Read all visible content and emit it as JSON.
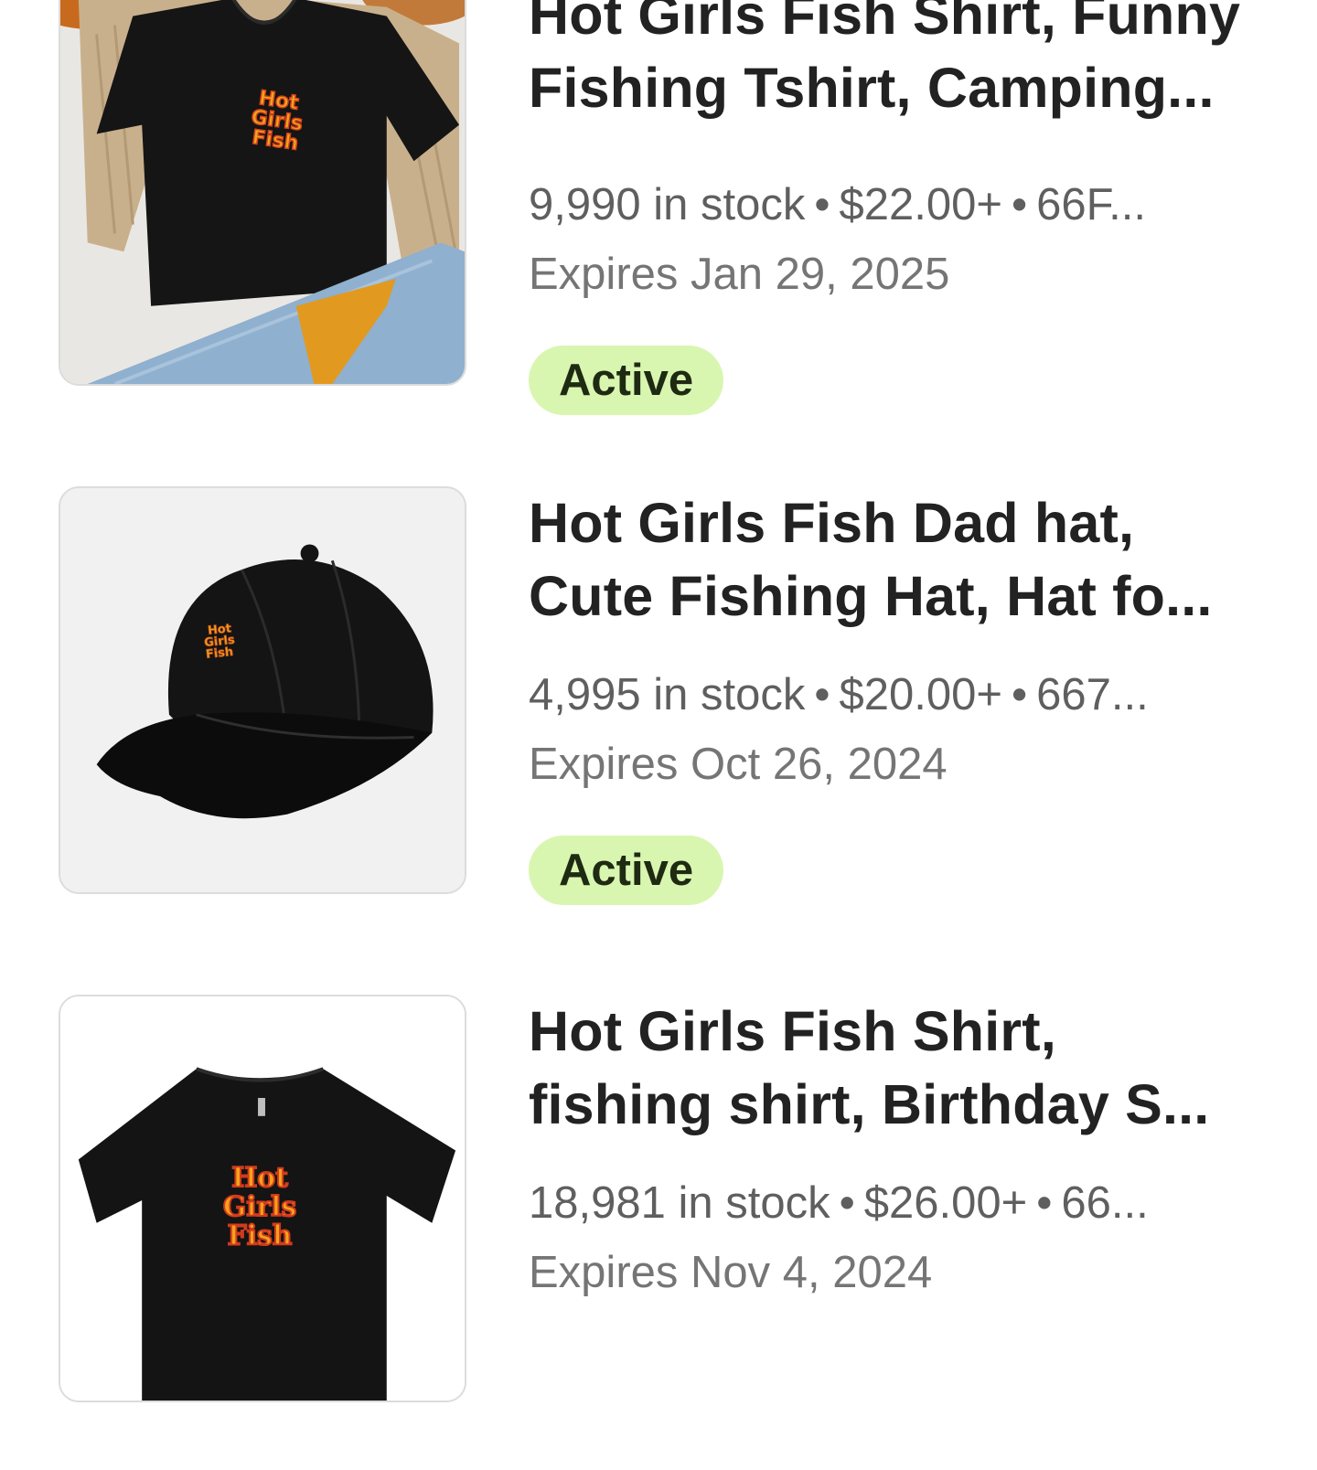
{
  "listings": [
    {
      "title_line1": "Hot Girls Fish Shirt, Funny",
      "title_line2": "Fishing Tshirt, Camping...",
      "stock": "9,990 in stock",
      "price": "$22.00+",
      "extra": "66F...",
      "expires": "Expires Jan 29, 2025",
      "status": "Active",
      "image": "black-vneck-tshirt-flatlay",
      "image_logo": [
        "Hot",
        "Girls",
        "Fish"
      ]
    },
    {
      "title_line1": "Hot Girls Fish Dad hat,",
      "title_line2": "Cute Fishing Hat, Hat fo...",
      "stock": "4,995 in stock",
      "price": "$20.00+",
      "extra": "667...",
      "expires": "Expires Oct 26, 2024",
      "status": "Active",
      "image": "black-dad-hat",
      "image_logo": [
        "Hot",
        "Girls",
        "Fish"
      ]
    },
    {
      "title_line1": "Hot Girls Fish Shirt,",
      "title_line2": "fishing shirt, Birthday S...",
      "stock": "18,981 in stock",
      "price": "$26.00+",
      "extra": "66...",
      "expires": "Expires Nov 4, 2024",
      "status": "",
      "image": "black-crop-tshirt",
      "image_logo": [
        "Hot",
        "Girls",
        "Fish"
      ]
    }
  ],
  "separator": "•",
  "colors": {
    "active_badge_bg": "#d8f6b0",
    "title": "#222222",
    "meta": "#5f5f5f"
  }
}
